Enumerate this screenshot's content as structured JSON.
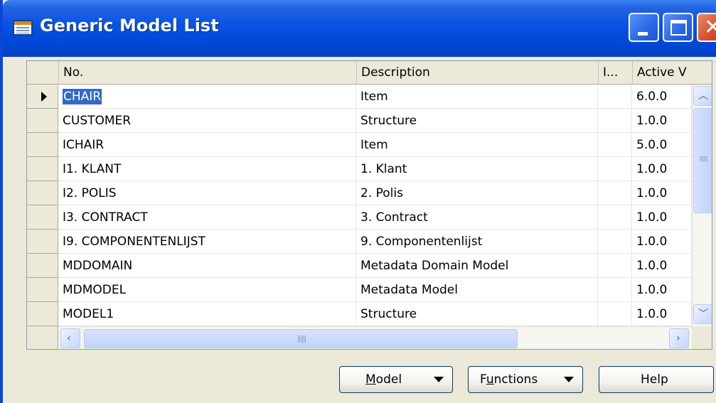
{
  "window": {
    "title": "Generic Model List"
  },
  "columns": [
    {
      "label": "No."
    },
    {
      "label": "Description"
    },
    {
      "label": "I..."
    },
    {
      "label": "Active V"
    }
  ],
  "rows": [
    {
      "no": "CHAIR",
      "description": "Item",
      "i": "",
      "active_version": "6.0.0",
      "selected": true
    },
    {
      "no": "CUSTOMER",
      "description": "Structure",
      "i": "",
      "active_version": "1.0.0"
    },
    {
      "no": "ICHAIR",
      "description": "Item",
      "i": "",
      "active_version": "5.0.0"
    },
    {
      "no": "I1. KLANT",
      "description": "1. Klant",
      "i": "",
      "active_version": "1.0.0"
    },
    {
      "no": "I2. POLIS",
      "description": "2. Polis",
      "i": "",
      "active_version": "1.0.0"
    },
    {
      "no": "I3. CONTRACT",
      "description": "3. Contract",
      "i": "",
      "active_version": "1.0.0"
    },
    {
      "no": "I9. COMPONENTENLIJST",
      "description": "9. Componentenlijst",
      "i": "",
      "active_version": "1.0.0"
    },
    {
      "no": "MDDOMAIN",
      "description": "Metadata Domain Model",
      "i": "",
      "active_version": "1.0.0"
    },
    {
      "no": "MDMODEL",
      "description": "Metadata Model",
      "i": "",
      "active_version": "1.0.0"
    },
    {
      "no": "MODEL1",
      "description": "Structure",
      "i": "",
      "active_version": "1.0.0"
    }
  ],
  "buttons": {
    "model_label": "Model",
    "functions_label": "Functions",
    "help_label": "Help"
  },
  "colors": {
    "titlebar": "#0a55e6",
    "selection": "#316ac5",
    "window_bg": "#ece9d8"
  }
}
